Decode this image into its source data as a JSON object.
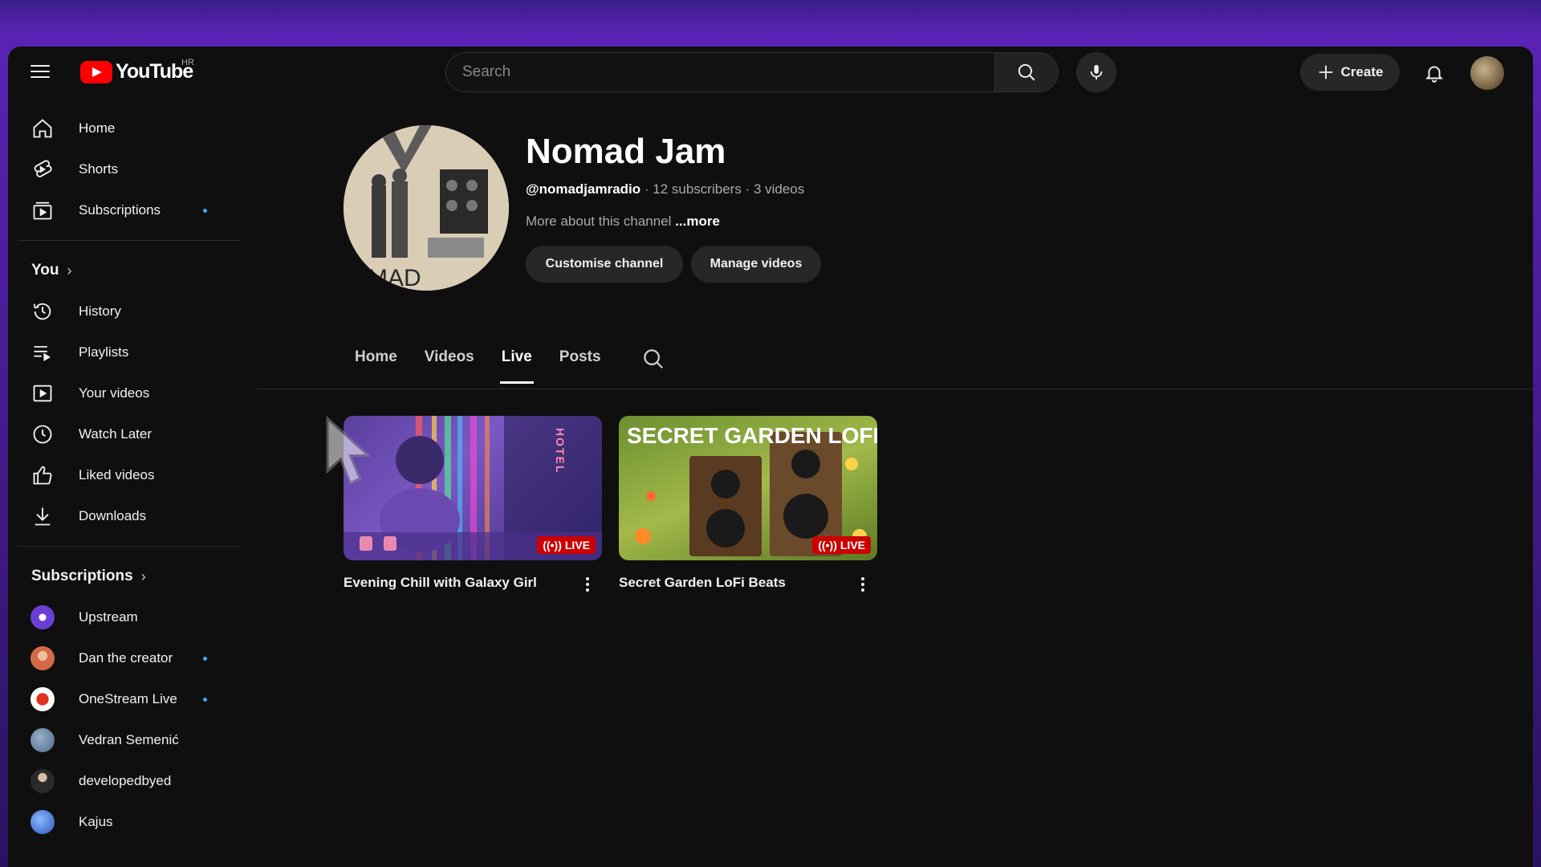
{
  "topbar": {
    "logo_text": "YouTube",
    "region": "HR",
    "search_placeholder": "Search",
    "create_label": "Create"
  },
  "sidebar": {
    "main": [
      {
        "label": "Home",
        "icon": "home-icon"
      },
      {
        "label": "Shorts",
        "icon": "shorts-icon"
      },
      {
        "label": "Subscriptions",
        "icon": "subscriptions-icon",
        "dot": true
      }
    ],
    "you_heading": "You",
    "you": [
      {
        "label": "History",
        "icon": "history-icon"
      },
      {
        "label": "Playlists",
        "icon": "playlists-icon"
      },
      {
        "label": "Your videos",
        "icon": "your-videos-icon"
      },
      {
        "label": "Watch Later",
        "icon": "clock-icon"
      },
      {
        "label": "Liked videos",
        "icon": "thumbs-up-icon"
      },
      {
        "label": "Downloads",
        "icon": "download-icon"
      }
    ],
    "subscriptions_heading": "Subscriptions",
    "subscriptions": [
      {
        "label": "Upstream",
        "color": "#6b3fd6",
        "dot": false
      },
      {
        "label": "Dan the creator",
        "color": "#d46a4a",
        "dot": true
      },
      {
        "label": "OneStream Live",
        "color": "#f08a24",
        "dot": true
      },
      {
        "label": "Vedran Semenić",
        "color": "#4a6a8a",
        "dot": false
      },
      {
        "label": "developedbyed",
        "color": "#8a7a6a",
        "dot": false
      },
      {
        "label": "Kajus",
        "color": "#3a7ad6",
        "dot": false
      }
    ]
  },
  "channel": {
    "name": "Nomad Jam",
    "handle": "@nomadjamradio",
    "subscribers": "12 subscribers",
    "videos": "3 videos",
    "separator": " · ",
    "about": "More about this channel",
    "more": "...more",
    "customise_label": "Customise channel",
    "manage_label": "Manage videos",
    "avatar_text": "MAD"
  },
  "tabs": [
    {
      "label": "Home",
      "active": false
    },
    {
      "label": "Videos",
      "active": false
    },
    {
      "label": "Live",
      "active": true
    },
    {
      "label": "Posts",
      "active": false
    }
  ],
  "videos": [
    {
      "title": "Evening Chill with Galaxy Girl",
      "badge": "LIVE",
      "thumb_text": "HOTEL"
    },
    {
      "title": "Secret Garden LoFi Beats",
      "badge": "LIVE",
      "thumb_text": "SECRET GARDEN LOFI"
    }
  ],
  "colors": {
    "accent_red": "#ff0000",
    "live_red": "#cc0000",
    "notification_dot": "#3ea6ff",
    "background": "#0f0f0f"
  }
}
